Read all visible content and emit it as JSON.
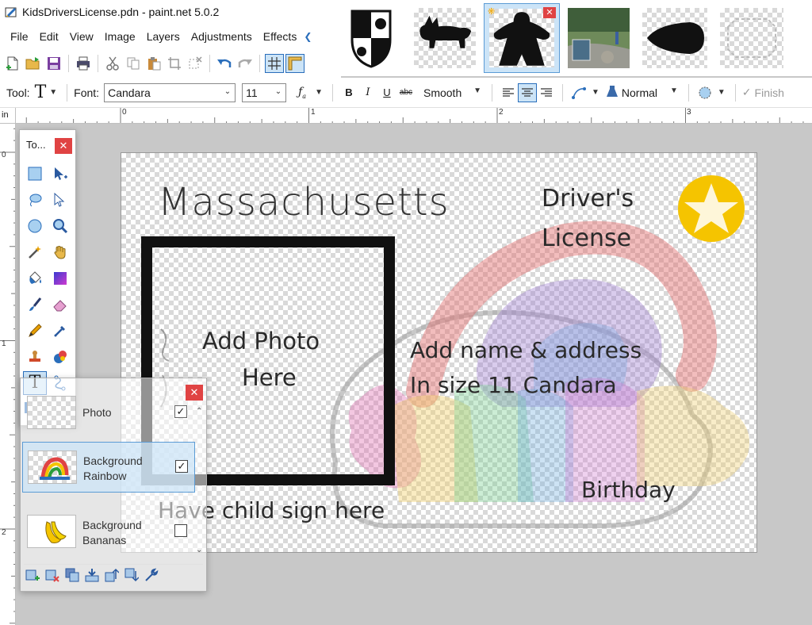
{
  "window": {
    "title": "KidsDriversLicense.pdn - paint.net 5.0.2"
  },
  "menu": {
    "items": [
      "File",
      "Edit",
      "View",
      "Image",
      "Layers",
      "Adjustments",
      "Effects"
    ]
  },
  "toolbar": {
    "tool_label": "Tool:",
    "font_label": "Font:",
    "font_value": "Candara",
    "size_value": "11",
    "bold": "B",
    "italic": "I",
    "underline": "U",
    "strikethrough": "abc",
    "antialias_value": "Smooth",
    "blend_value": "Normal",
    "finish_label": "Finish"
  },
  "ruler": {
    "unit": "in",
    "h_labels": [
      "0",
      "1",
      "2",
      "3"
    ],
    "v_labels": [
      "0",
      "1",
      "2"
    ]
  },
  "canvas_text": {
    "state": "Massachusetts",
    "license_line1": "Driver's",
    "license_line2": "License",
    "photo_line1": "Add Photo",
    "photo_line2": "Here",
    "name_line1": "Add name & address",
    "name_line2": "In size 11 Candara",
    "birthday": "Birthday",
    "sign": "Have child sign here"
  },
  "tools_window": {
    "title": "To..."
  },
  "layers": [
    {
      "name": "Photo",
      "visible": true
    },
    {
      "name": "Background Rainbow",
      "visible": true,
      "selected": true
    },
    {
      "name": "Background Bananas",
      "visible": false
    }
  ],
  "colors": {
    "accent": "#2a6ebb",
    "close_red": "#e04343",
    "star_yellow": "#f5c400"
  }
}
